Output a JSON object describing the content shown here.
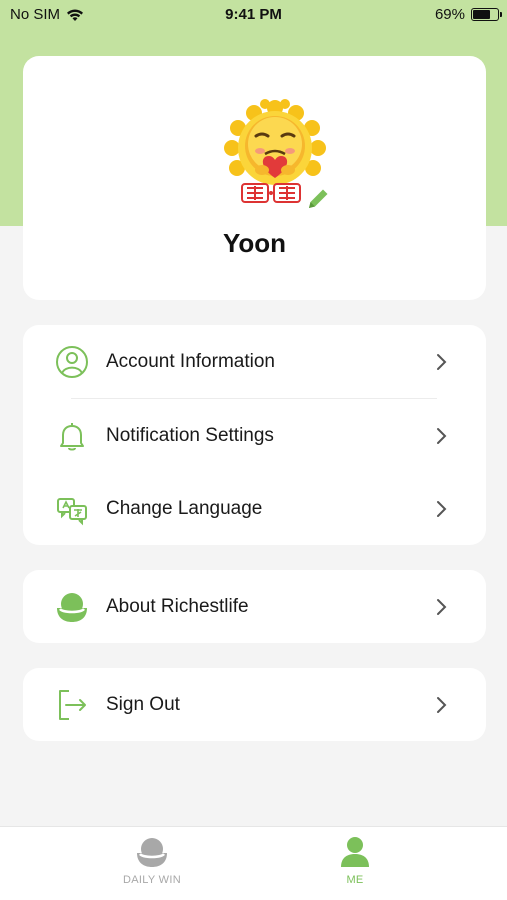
{
  "status_bar": {
    "carrier": "No SIM",
    "time": "9:41 PM",
    "battery_percent": "69%",
    "battery_level": 0.69
  },
  "profile": {
    "name": "Yoon",
    "avatar_icon": "sun-mascot-avatar",
    "edit_icon": "pencil-icon"
  },
  "menu": {
    "account_information": "Account Information",
    "notification_settings": "Notification Settings",
    "change_language": "Change Language",
    "about": "About Richestlife",
    "sign_out": "Sign Out"
  },
  "tabs": {
    "daily_win": "DAILY WIN",
    "me": "ME",
    "active": "ME"
  },
  "colors": {
    "accent": "#7cc05a",
    "header_band": "#c3e2a0",
    "background": "#f4f4f4",
    "inactive_tab": "#a8a8a8"
  }
}
